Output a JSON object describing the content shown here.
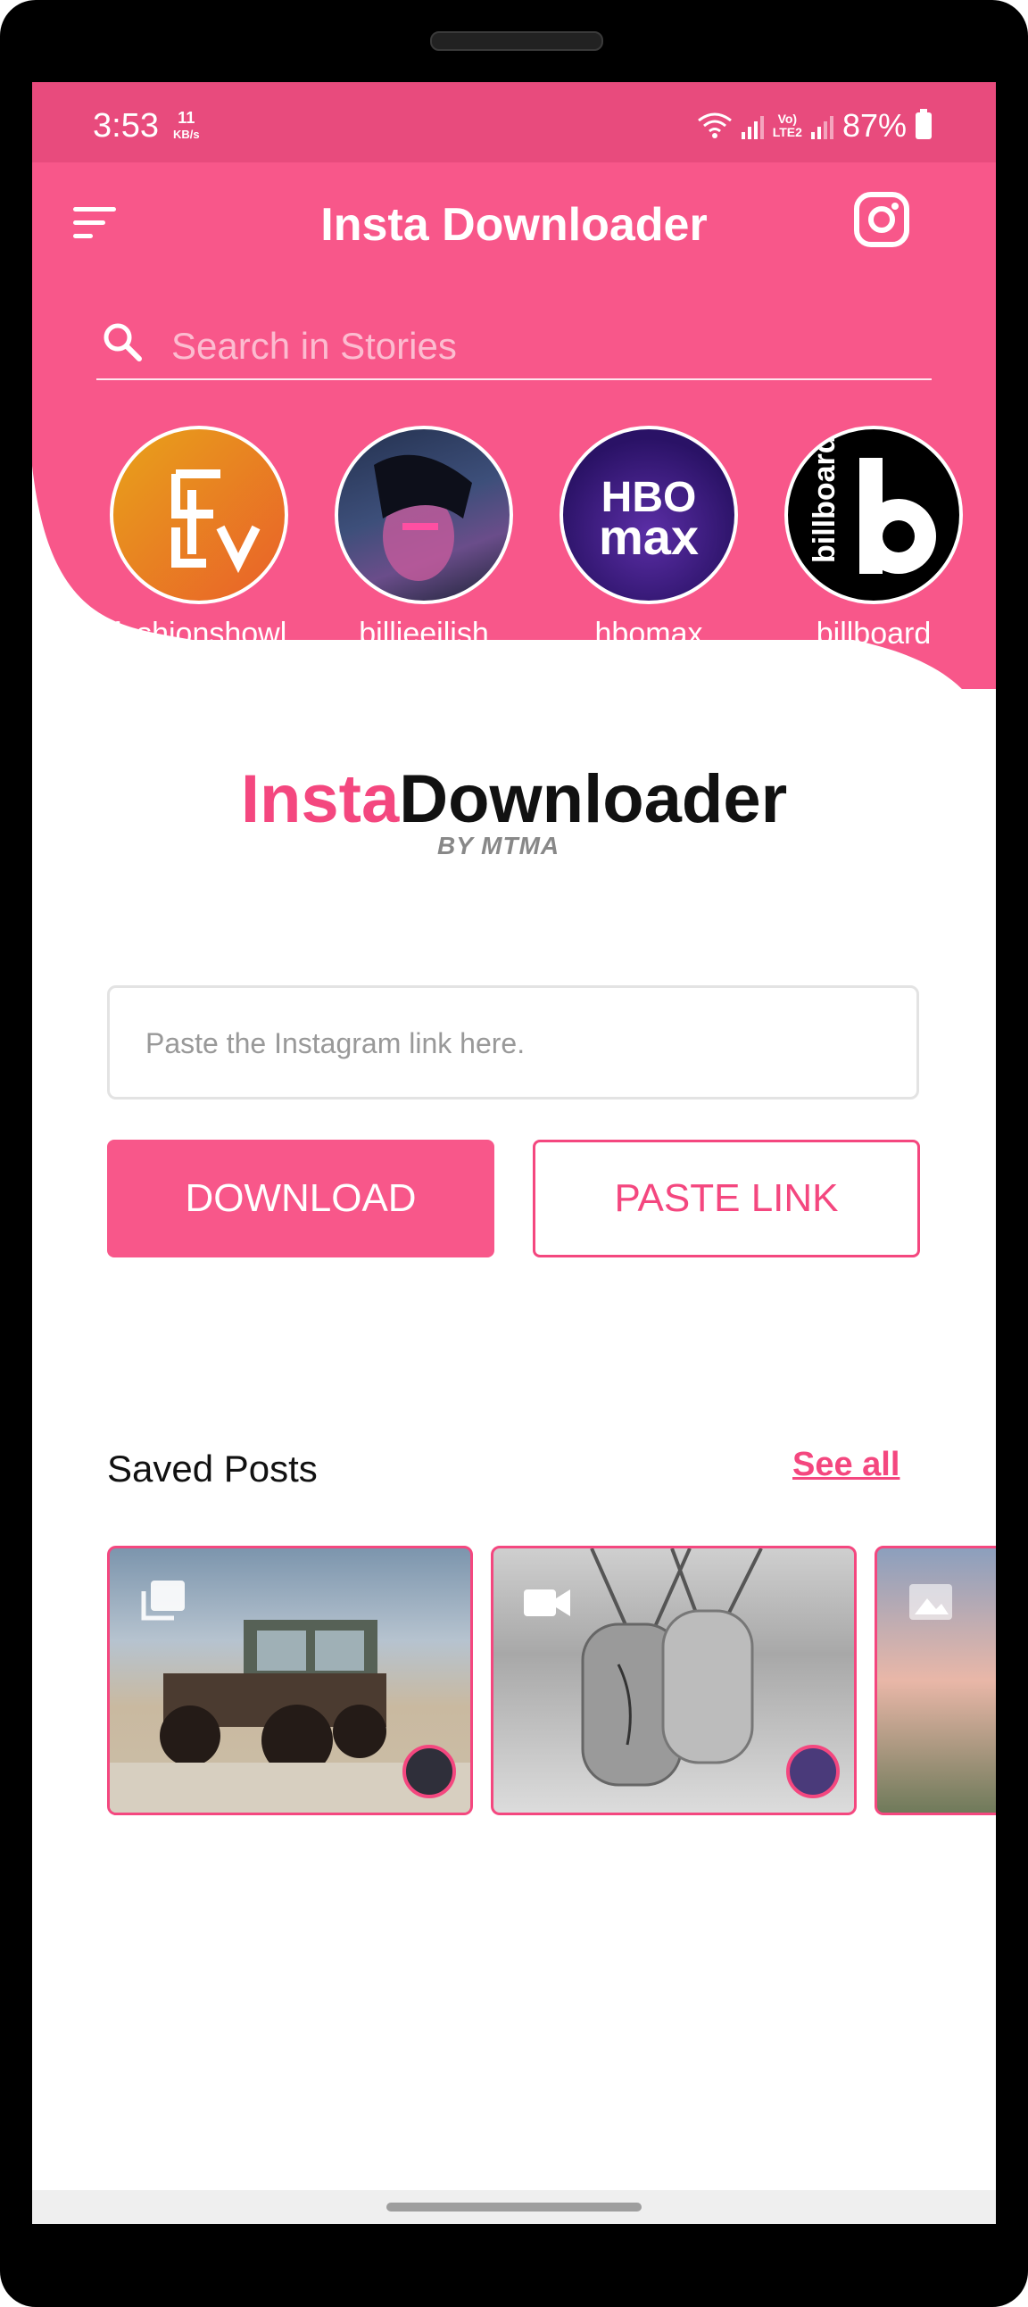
{
  "status_bar": {
    "time": "3:53",
    "net_speed_value": "11",
    "net_speed_unit": "KB/s",
    "volte_label": "Vo)",
    "lte_label": "LTE2",
    "battery": "87%"
  },
  "header": {
    "title": "Insta Downloader",
    "menu_icon": "menu-icon",
    "instagram_icon": "instagram-icon"
  },
  "search": {
    "placeholder": "Search in Stories",
    "icon": "search-icon"
  },
  "stories": [
    {
      "name": "fashionshowl"
    },
    {
      "name": "billieeilish"
    },
    {
      "name": "hbomax"
    },
    {
      "name": "billboard"
    }
  ],
  "logo": {
    "part1": "Insta",
    "part2": "Downloader",
    "byline": "BY MTMA"
  },
  "link_input": {
    "placeholder": "Paste the Instagram link here."
  },
  "buttons": {
    "download": "DOWNLOAD",
    "paste_link": "PASTE LINK"
  },
  "saved_posts": {
    "title": "Saved Posts",
    "see_all": "See all",
    "items": [
      {
        "type": "carousel-icon"
      },
      {
        "type": "video-icon"
      },
      {
        "type": "image-icon"
      }
    ]
  },
  "colors": {
    "accent": "#f8578a",
    "status_bar": "#e84b7d"
  }
}
